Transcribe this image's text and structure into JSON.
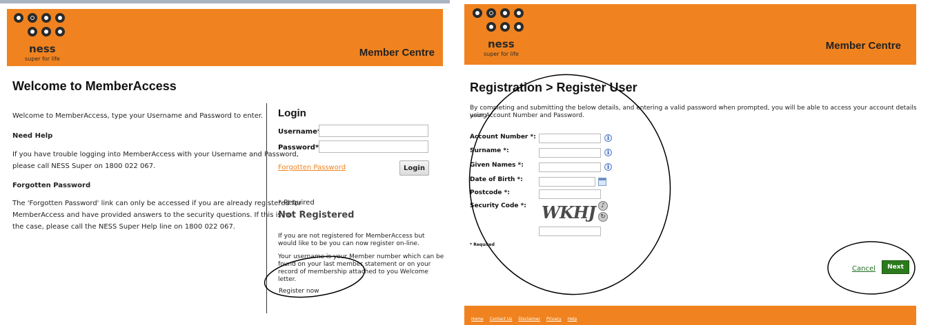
{
  "brand": {
    "logo_word": "ness",
    "logo_tagline": "super for life",
    "header_title": "Member Centre",
    "accent_color": "#f0831f"
  },
  "login_page": {
    "title": "Welcome to MemberAccess",
    "intro": "Welcome to MemberAccess, type your Username and Password to enter.",
    "need_help_heading": "Need Help",
    "need_help_text_1": "If you have trouble logging into MemberAccess with your Username and Password,",
    "need_help_text_2": "please call NESS Super on 1800 022 067.",
    "forgotten_heading": "Forgotten Password",
    "forgotten_text_1": "The 'Forgotten Password' link can only be accessed if you are already registered for",
    "forgotten_text_2": "MemberAccess and have provided answers to the security questions. If this is not",
    "forgotten_text_3": "the case, please call the NESS Super Help line on 1800 022 067.",
    "login_box": {
      "title": "Login",
      "username_label": "Username*:",
      "password_label": "Password*:",
      "username_value": "",
      "password_value": "",
      "forgotten_link": "Forgotten Password",
      "login_button": "Login",
      "required_note": "* Required"
    },
    "not_registered": {
      "heading": "Not Registered",
      "text_1": "If you are not registered for MemberAccess but",
      "text_2": "would like to be you can now register on-line.",
      "text_3": "Your username is your Member number which can be",
      "text_4": "found on your last member statement or on your",
      "text_5": "record of membership attached to you Welcome",
      "text_6": "letter.",
      "register_link": "Register now"
    }
  },
  "register_page": {
    "title": "Registration > Register User",
    "intro_1": "By completing and submitting the below details, and entering a valid password when prompted, you will be able to access your account details using",
    "intro_2": "your Account Number and Password.",
    "fields": {
      "account_number": "Account Number *:",
      "surname": "Surname *:",
      "given_names": "Given Names *:",
      "date_of_birth": "Date of Birth *:",
      "postcode": "Postcode *:",
      "security_code": "Security Code *:"
    },
    "captcha_text": "WKHJ",
    "required_note": "* Required",
    "cancel_link": "Cancel",
    "next_button": "Next"
  },
  "footer": {
    "links": [
      "Home",
      "Contact Us",
      "Disclaimer",
      "Privacy",
      "Help"
    ]
  },
  "icons": {
    "info": "i",
    "refresh": "↻",
    "audio": "♪"
  }
}
